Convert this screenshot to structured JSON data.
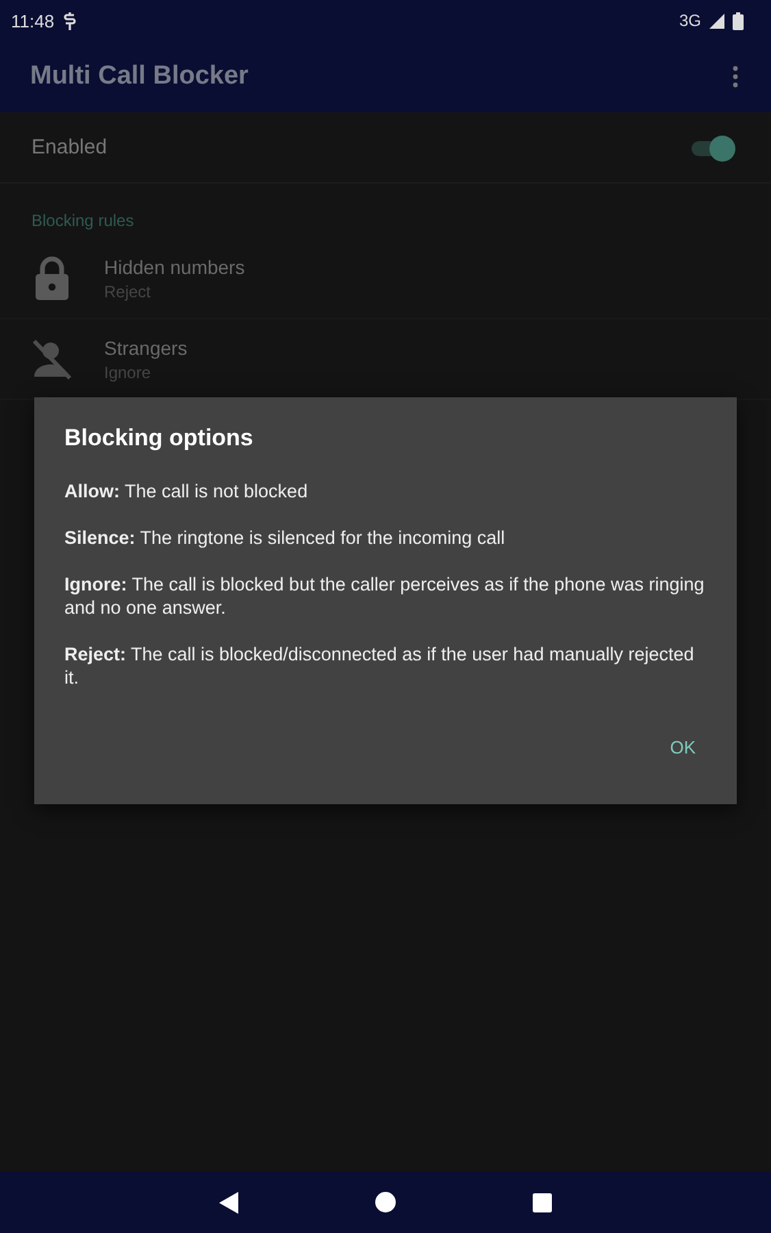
{
  "status_bar": {
    "time": "11:48",
    "network": "3G"
  },
  "app_bar": {
    "title": "Multi Call Blocker"
  },
  "enabled": {
    "label": "Enabled",
    "on": true
  },
  "section": {
    "title": "Blocking rules"
  },
  "rules": [
    {
      "kind": "lock",
      "title": "Hidden numbers",
      "value": "Reject"
    },
    {
      "kind": "person-off",
      "title": "Strangers",
      "value": "Ignore"
    }
  ],
  "dialog": {
    "title": "Blocking options",
    "paragraphs": [
      "**Allow:** The call is not blocked",
      "**Silence:** The ringtone is silenced for the incoming call",
      "**Ignore:** The call is blocked but the caller perceives as if the phone was ringing and no one answer.",
      "**Reject:** The call is blocked/disconnected as if the user had manually rejected it."
    ],
    "button": "OK"
  }
}
